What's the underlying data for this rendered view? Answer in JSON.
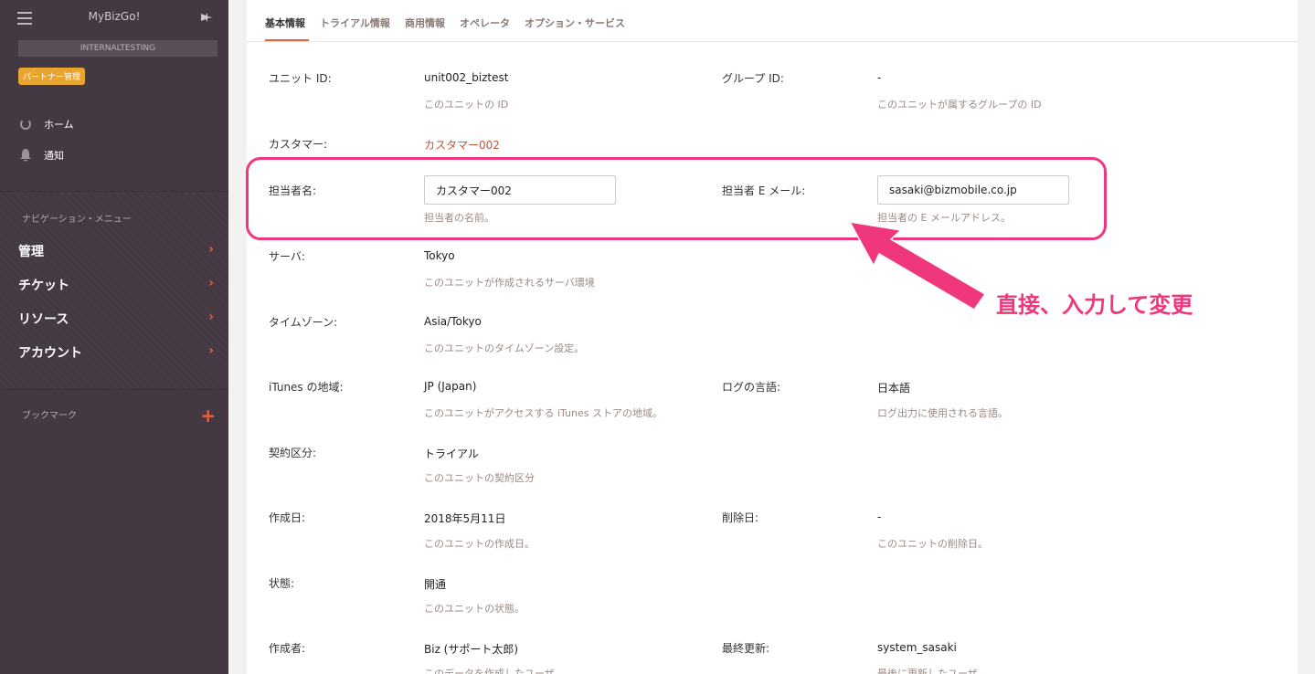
{
  "sidebar": {
    "app_title": "MyBizGo!",
    "env_label": "INTERNALTESTING",
    "partner_badge": "パートナー管理",
    "home_label": "ホーム",
    "notify_label": "通知",
    "nav_section_label": "ナビゲーション・メニュー",
    "nav_items": [
      {
        "label": "管理"
      },
      {
        "label": "チケット"
      },
      {
        "label": "リソース"
      },
      {
        "label": "アカウント"
      }
    ],
    "bookmark_label": "ブックマーク",
    "icons": {
      "menu": "hamburger-icon",
      "pin": "pin-icon",
      "home": "home-icon",
      "bell": "bell-icon",
      "add": "plus-icon",
      "chevron": "chevron-right-icon"
    }
  },
  "tabs": [
    {
      "label": "基本情報",
      "active": true
    },
    {
      "label": "トライアル情報"
    },
    {
      "label": "商用情報"
    },
    {
      "label": "オペレータ"
    },
    {
      "label": "オプション・サービス"
    }
  ],
  "fields": {
    "unit_id": {
      "label": "ユニット ID:",
      "value": "unit002_biztest",
      "help": "このユニットの ID"
    },
    "group_id": {
      "label": "グループ ID:",
      "value": "-",
      "help": "このユニットが属するグループの ID"
    },
    "customer": {
      "label": "カスタマー:",
      "value": "カスタマー002"
    },
    "contact_name": {
      "label": "担当者名:",
      "value": "カスタマー002",
      "help": "担当者の名前。"
    },
    "contact_email": {
      "label": "担当者 E メール:",
      "value": "sasaki@bizmobile.co.jp",
      "help": "担当者の E メールアドレス。"
    },
    "server": {
      "label": "サーバ:",
      "value": "Tokyo",
      "help": "このユニットが作成されるサーバ環境"
    },
    "timezone": {
      "label": "タイムゾーン:",
      "value": "Asia/Tokyo",
      "help": "このユニットのタイムゾーン設定。"
    },
    "itunes_region": {
      "label": "iTunes の地域:",
      "value": "JP (Japan)",
      "help": "このユニットがアクセスする iTunes ストアの地域。"
    },
    "log_language": {
      "label": "ログの言語:",
      "value": "日本語",
      "help": "ログ出力に使用される言語。"
    },
    "contract_type": {
      "label": "契約区分:",
      "value": "トライアル",
      "help": "このユニットの契約区分"
    },
    "created_date": {
      "label": "作成日:",
      "value": "2018年5月11日",
      "help": "このユニットの作成日。"
    },
    "deleted_date": {
      "label": "削除日:",
      "value": "-",
      "help": "このユニットの削除日。"
    },
    "status": {
      "label": "状態:",
      "value": "開通",
      "help": "このユニットの状態。"
    },
    "creator": {
      "label": "作成者:",
      "value": "Biz (サポート太郎)",
      "help": "このデータを作成したユーザ"
    },
    "last_updated": {
      "label": "最終更新:",
      "value": "system_sasaki",
      "help": "最後に更新したユーザ"
    }
  },
  "annotation": {
    "text": "直接、入力して変更",
    "color": "#f0377e"
  },
  "colors": {
    "sidebar_bg": "#443942",
    "accent": "#e8603c",
    "badge": "#e8a631",
    "link": "#c0553a"
  }
}
